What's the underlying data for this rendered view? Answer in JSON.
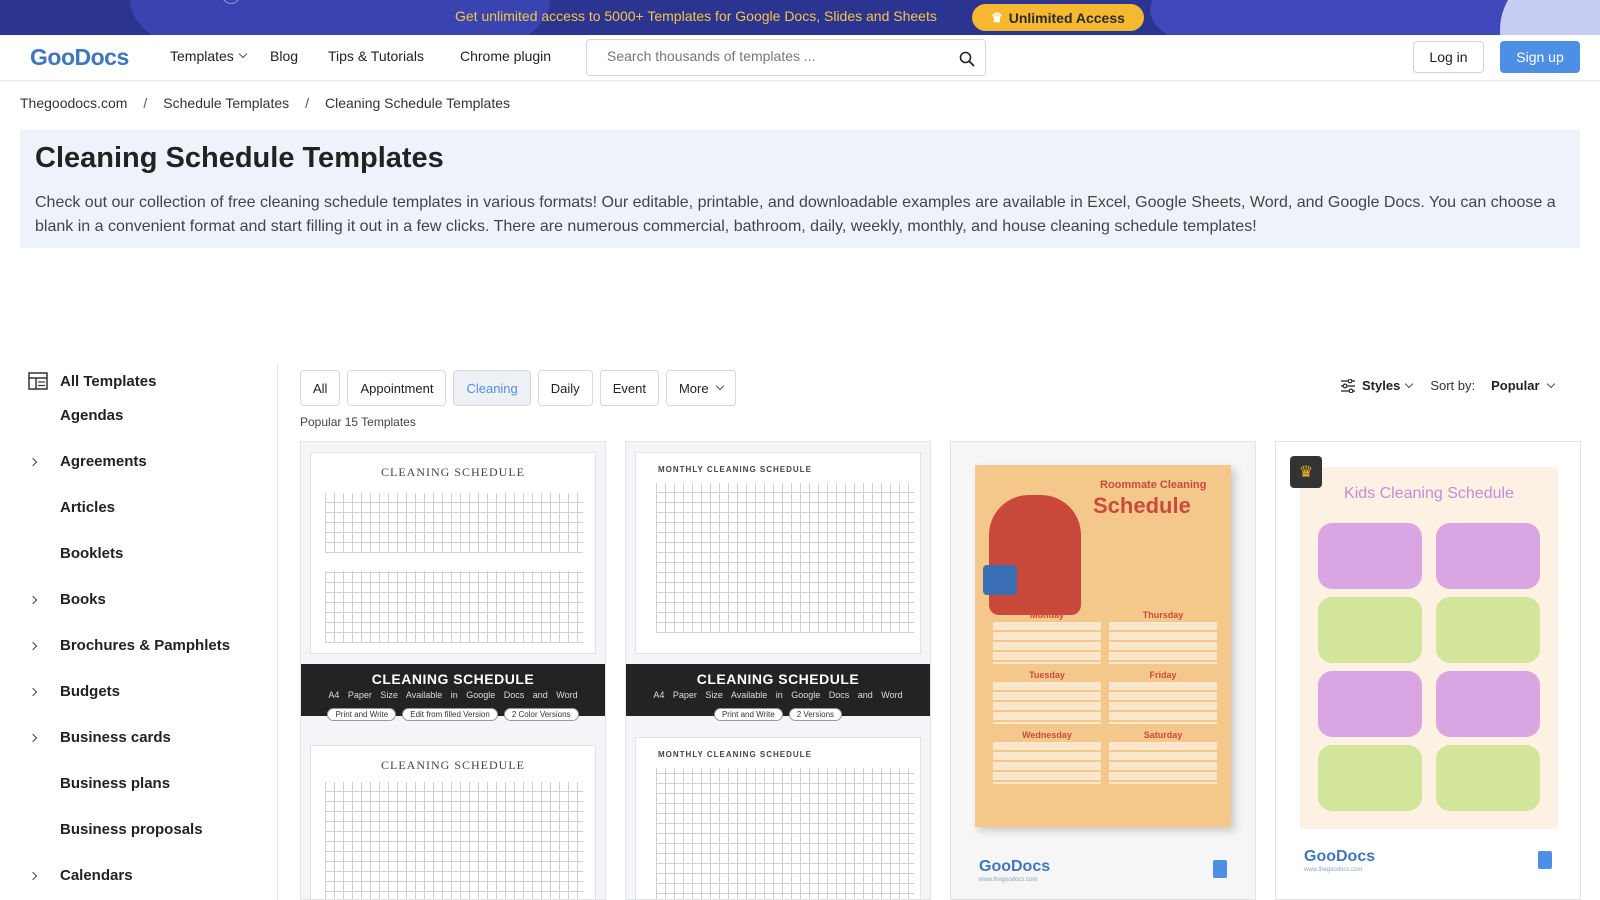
{
  "promo": {
    "text": "Get unlimited access to 5000+ Templates for Google Docs, Slides and Sheets",
    "button_label": "Unlimited Access",
    "button_icon": "crown-icon"
  },
  "header": {
    "logo": "GooDocs",
    "nav": [
      "Templates",
      "Blog",
      "Tips & Tutorials",
      "Chrome plugin"
    ],
    "search_placeholder": "Search thousands of templates ...",
    "login": "Log in",
    "signup": "Sign up"
  },
  "breadcrumb": [
    "Thegoodocs.com",
    "Schedule Templates",
    "Cleaning Schedule Templates"
  ],
  "breadcrumb_sep": "/",
  "hero": {
    "title": "Cleaning Schedule Templates",
    "description": "Check out our collection of free cleaning schedule templates in various formats! Our editable, printable, and downloadable examples are available in Excel, Google Sheets, Word, and Google Docs. You can choose a blank in a convenient format and start filling it out in a few clicks. There are numerous commercial, bathroom, daily, weekly, monthly, and house cleaning schedule templates!"
  },
  "sidebar": {
    "all_label": "All Templates",
    "items": [
      {
        "label": "Agendas",
        "expandable": false
      },
      {
        "label": "Agreements",
        "expandable": true
      },
      {
        "label": "Articles",
        "expandable": false
      },
      {
        "label": "Booklets",
        "expandable": false
      },
      {
        "label": "Books",
        "expandable": true
      },
      {
        "label": "Brochures & Pamphlets",
        "expandable": true
      },
      {
        "label": "Budgets",
        "expandable": true
      },
      {
        "label": "Business cards",
        "expandable": true
      },
      {
        "label": "Business plans",
        "expandable": false
      },
      {
        "label": "Business proposals",
        "expandable": false
      },
      {
        "label": "Calendars",
        "expandable": true
      }
    ]
  },
  "filters": {
    "chips": [
      "All",
      "Appointment",
      "Cleaning",
      "Daily",
      "Event"
    ],
    "active": "Cleaning",
    "more": "More",
    "styles": "Styles",
    "sort_label": "Sort by:",
    "sort_value": "Popular"
  },
  "count_text": "Popular 15 Templates",
  "cards": {
    "c1": {
      "sheet_title": "CLEANING SCHEDULE",
      "band_title": "CLEANING SCHEDULE",
      "band_sub": "A4 Paper Size   Available in Google Docs and Word",
      "pills": [
        "Print and Write",
        "Edit from filled Version",
        "2 Color Versions"
      ]
    },
    "c2": {
      "sheet_title": "MONTHLY CLEANING SCHEDULE",
      "band_title": "CLEANING SCHEDULE",
      "band_sub": "A4 Paper Size   Available in Google Docs and Word",
      "pills": [
        "Print and Write",
        "2 Versions"
      ]
    },
    "c3": {
      "title_small": "Roommate Cleaning",
      "title_big": "Schedule",
      "days": [
        "Monday",
        "Thursday",
        "Tuesday",
        "Friday",
        "Wednesday",
        "Saturday"
      ],
      "footer_logo": "GooDocs",
      "footer_sub": "www.thegoodocs.com",
      "footer_icon_label": "Docs"
    },
    "c4": {
      "title": "Kids Cleaning Schedule",
      "footer_logo": "GooDocs",
      "footer_sub": "www.thegoodocs.com",
      "footer_icon_label": "Docs",
      "badge_icon": "crown-icon"
    }
  },
  "colors": {
    "promo_bg": "#2c3492",
    "promo_text": "#f3c545",
    "accent": "#4e8fe6",
    "hero_bg": "#eef3fb"
  }
}
